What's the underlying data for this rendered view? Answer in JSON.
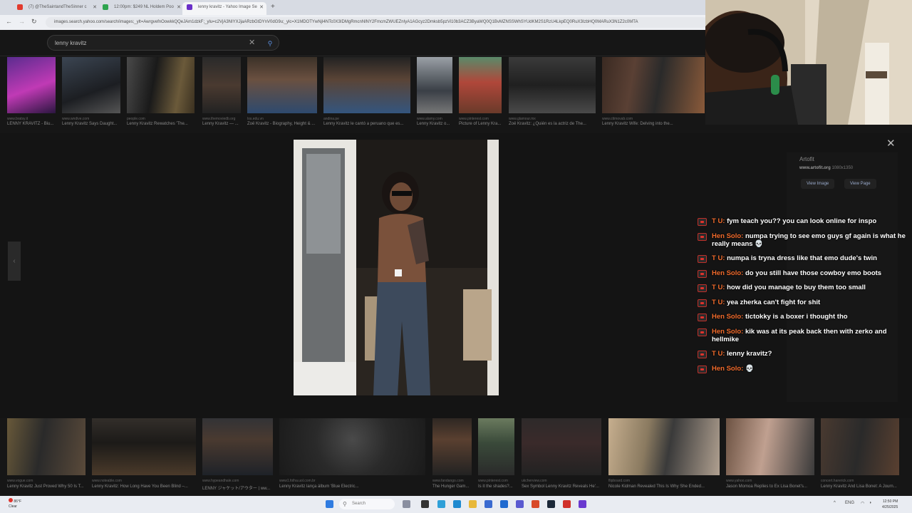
{
  "browser": {
    "tabs": [
      {
        "label": "(7) @TheSaintandTheSinner c",
        "color": "#e23b2e"
      },
      {
        "label": "12:00pm: $249 NL Holdem Poo",
        "color": "#2ea44f"
      },
      {
        "label": "lenny kravitz - Yahoo Image Se",
        "color": "#6a2fc8"
      }
    ],
    "url": "images.search.yahoo.com/search/images;_ylt=AwrgvefnOowkkQQeJAm1dzkF;_ylu=c2VjA3NIYXJjaARzbGtDYnV0dG9u;_ylc=X1MDOTYwNjI4NTc0X3IDMgRmcnNlNY2FmcmZWUEZnIyA1AGcyz2Dmksb5pzVi10b3ACZ3ByaWQ0Q1BvMZNSSWhSYUdKM2S1RzU4LkpEQ0RuX3IzbHQ0MARuX3N1Z2c0MTA"
  },
  "search": {
    "query": "lenny kravitz"
  },
  "top_row": [
    {
      "source": "www.bratsy.it",
      "title": "LENNY KRAVITZ - Biu..."
    },
    {
      "source": "www.wndive.com",
      "title": "Lenny Kravitz Says Daught..."
    },
    {
      "source": "people.com",
      "title": "Lenny Kravitz Rewatches 'The..."
    },
    {
      "source": "www.themoviedb.org",
      "title": "Lenny Kravitz — ..."
    },
    {
      "source": "los.edu.vn",
      "title": "Zoë Kravitz - Biography, Height & ..."
    },
    {
      "source": "andina.pe",
      "title": "Lenny Kravitz le cantó a peruano que es..."
    },
    {
      "source": "www.alamy.com",
      "title": "Lenny Kravitz o..."
    },
    {
      "source": "www.pinterest.com",
      "title": "Picture of Lenny Kra..."
    },
    {
      "source": "www.glamour.mx",
      "title": "Zoë Kravitz: ¿Quién es la actriz de The..."
    },
    {
      "source": "www.cttmovab.com",
      "title": "Lenny Kravitz Wife: Delving into the..."
    }
  ],
  "viewer": {
    "site_name": "Artofit",
    "domain": "www.artofit.org",
    "dimensions": "1080x1350",
    "view_image": "View Image",
    "view_page": "View Page",
    "close": "✕",
    "prev": "‹"
  },
  "chat": [
    {
      "user": "T U:",
      "text": "fym teach you?? you can look online for inspo"
    },
    {
      "user": "Hen Solo:",
      "text": "numpa trying to see emo guys gf again is what he really means 💀"
    },
    {
      "user": "T U:",
      "text": "numpa is tryna dress like that emo dude's twin"
    },
    {
      "user": "Hen Solo:",
      "text": "do you still have those cowboy emo boots"
    },
    {
      "user": "T U:",
      "text": "how did you manage to buy them too small"
    },
    {
      "user": "T U:",
      "text": "yea zherka can't fight for shit"
    },
    {
      "user": "Hen Solo:",
      "text": "tictokky is a boxer i thought tho"
    },
    {
      "user": "Hen Solo:",
      "text": "kik was at its peak back then with zerko and hellmike"
    },
    {
      "user": "T U:",
      "text": "lenny kravitz?"
    },
    {
      "user": "Hen Solo:",
      "text": "💀"
    }
  ],
  "bottom_row": [
    {
      "source": "www.vogue.com",
      "title": "Lenny Kravitz Just Proved Why 50 Is T..."
    },
    {
      "source": "www.noteable.com",
      "title": "Lenny Kravitz: How Long Have You Been Blind –..."
    },
    {
      "source": "www.hypeandhale.com",
      "title": "LENNY ジャケット/アウター | ww..."
    },
    {
      "source": "www1.folha.uol.com.br",
      "title": "Lenny Kravitz lança álbum 'Blue Electric..."
    },
    {
      "source": "www.fandango.com",
      "title": "The Hunger Gam..."
    },
    {
      "source": "www.pinterest.com",
      "title": "Is it the shades?..."
    },
    {
      "source": "ukcherview.com",
      "title": "Sex Symbol Lenny Kravitz Reveals He'..."
    },
    {
      "source": "flipboard.com",
      "title": "Nicole Kidman Revealed This Is Why She Ended..."
    },
    {
      "source": "www.yahoo.com",
      "title": "Jason Momoa Replies to Ex Lisa Bonet's..."
    },
    {
      "source": "concert.harerick.com",
      "title": "Lenny Kravitz And Lisa Bonet: A Journ..."
    }
  ],
  "taskbar": {
    "weather_temp": "86°F",
    "weather_desc": "Clear",
    "search_placeholder": "Search",
    "lang": "ENG",
    "time": "12:50 PM",
    "date": "4/25/2025"
  }
}
